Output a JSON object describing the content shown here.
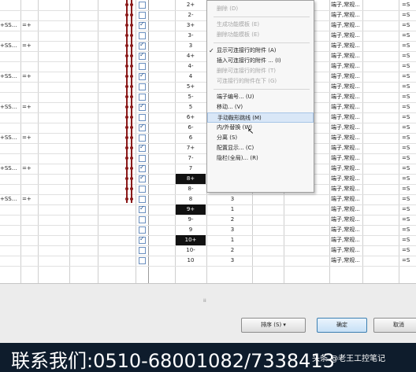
{
  "rows": [
    {
      "pin": "2+",
      "hl": false,
      "idx": "",
      "type": "端子,常规...",
      "eq": "=S",
      "checked": false,
      "left": "",
      "left2": ""
    },
    {
      "pin": "2-",
      "hl": false,
      "idx": "",
      "type": "端子,常规...",
      "eq": "=S",
      "checked": false,
      "left": "",
      "left2": ""
    },
    {
      "pin": "3+",
      "hl": false,
      "idx": "",
      "type": "端子,常规...",
      "eq": "=S",
      "checked": true,
      "left": "+SS...",
      "left2": "=+"
    },
    {
      "pin": "3-",
      "hl": false,
      "idx": "",
      "type": "端子,常规...",
      "eq": "=S",
      "checked": false,
      "left": "",
      "left2": ""
    },
    {
      "pin": "3",
      "hl": false,
      "idx": "",
      "type": "端子,常规...",
      "eq": "=S",
      "checked": true,
      "left": "+SS...",
      "left2": "=+"
    },
    {
      "pin": "4+",
      "hl": false,
      "idx": "",
      "type": "端子,常规...",
      "eq": "=S",
      "checked": true,
      "left": "",
      "left2": ""
    },
    {
      "pin": "4-",
      "hl": false,
      "idx": "",
      "type": "端子,常规...",
      "eq": "=S",
      "checked": false,
      "left": "",
      "left2": ""
    },
    {
      "pin": "4",
      "hl": false,
      "idx": "",
      "type": "端子,常规...",
      "eq": "=S",
      "checked": true,
      "left": "+SS...",
      "left2": "=+"
    },
    {
      "pin": "5+",
      "hl": false,
      "idx": "",
      "type": "端子,常规...",
      "eq": "=S",
      "checked": false,
      "left": "",
      "left2": ""
    },
    {
      "pin": "5-",
      "hl": false,
      "idx": "",
      "type": "端子,常规...",
      "eq": "=S",
      "checked": false,
      "left": "",
      "left2": ""
    },
    {
      "pin": "5",
      "hl": false,
      "idx": "",
      "type": "端子,常规...",
      "eq": "=S",
      "checked": true,
      "left": "+SS...",
      "left2": "=+"
    },
    {
      "pin": "6+",
      "hl": false,
      "idx": "",
      "type": "端子,常规...",
      "eq": "=S",
      "checked": false,
      "left": "",
      "left2": ""
    },
    {
      "pin": "6-",
      "hl": false,
      "idx": "",
      "type": "端子,常规...",
      "eq": "=S",
      "checked": true,
      "left": "",
      "left2": ""
    },
    {
      "pin": "6",
      "hl": false,
      "idx": "",
      "type": "端子,常规...",
      "eq": "=S",
      "checked": false,
      "left": "+SS...",
      "left2": "=+"
    },
    {
      "pin": "7+",
      "hl": false,
      "idx": "",
      "type": "端子,常规...",
      "eq": "=S",
      "checked": true,
      "left": "",
      "left2": ""
    },
    {
      "pin": "7-",
      "hl": false,
      "idx": "",
      "type": "端子,常规...",
      "eq": "=S",
      "checked": false,
      "left": "",
      "left2": ""
    },
    {
      "pin": "7",
      "hl": false,
      "idx": "",
      "type": "端子,常规...",
      "eq": "=S",
      "checked": true,
      "left": "+SS...",
      "left2": "=+"
    },
    {
      "pin": "8+",
      "hl": true,
      "idx": "",
      "type": "端子,常规...",
      "eq": "=S",
      "checked": true,
      "left": "",
      "left2": ""
    },
    {
      "pin": "8-",
      "hl": false,
      "idx": "2",
      "type": "端子,常规...",
      "eq": "=S",
      "checked": false,
      "left": "",
      "left2": ""
    },
    {
      "pin": "8",
      "hl": false,
      "idx": "3",
      "type": "端子,常规...",
      "eq": "=S",
      "checked": false,
      "left": "+SS...",
      "left2": "=+"
    },
    {
      "pin": "9+",
      "hl": true,
      "idx": "1",
      "type": "端子,常规...",
      "eq": "=S",
      "checked": true,
      "left": "",
      "left2": ""
    },
    {
      "pin": "9-",
      "hl": false,
      "idx": "2",
      "type": "端子,常规...",
      "eq": "=S",
      "checked": false,
      "left": "",
      "left2": ""
    },
    {
      "pin": "9",
      "hl": false,
      "idx": "3",
      "type": "端子,常规...",
      "eq": "=S",
      "checked": false,
      "left": "",
      "left2": ""
    },
    {
      "pin": "10+",
      "hl": true,
      "idx": "1",
      "type": "端子,常规...",
      "eq": "=S",
      "checked": true,
      "left": "",
      "left2": ""
    },
    {
      "pin": "10-",
      "hl": false,
      "idx": "2",
      "type": "端子,常规...",
      "eq": "=S",
      "checked": false,
      "left": "",
      "left2": ""
    },
    {
      "pin": "10",
      "hl": false,
      "idx": "3",
      "type": "端子,常规...",
      "eq": "=S",
      "checked": false,
      "left": "",
      "left2": ""
    }
  ],
  "menu": [
    {
      "label": "删除 (D)",
      "disabled": true,
      "checked": false,
      "hover": false
    },
    {
      "sep": true
    },
    {
      "label": "生成功能模板 (E)",
      "disabled": true,
      "checked": false,
      "hover": false
    },
    {
      "label": "删除功能模板 (E)",
      "disabled": true,
      "checked": false,
      "hover": false
    },
    {
      "sep": true
    },
    {
      "label": "显示可连接行的附件 (A)",
      "disabled": false,
      "checked": true,
      "hover": false
    },
    {
      "label": "插入可连接行的附件 ... (I)",
      "disabled": false,
      "checked": false,
      "hover": false
    },
    {
      "label": "删除可连接行的附件 (T)",
      "disabled": true,
      "checked": false,
      "hover": false
    },
    {
      "label": "可连接行的附件在下 (G)",
      "disabled": true,
      "checked": false,
      "hover": false
    },
    {
      "sep": true
    },
    {
      "label": "端子编号... (U)",
      "disabled": false,
      "checked": false,
      "hover": false
    },
    {
      "label": "移动... (V)",
      "disabled": false,
      "checked": false,
      "hover": false
    },
    {
      "label": "手动鞍形跳线 (M)",
      "disabled": false,
      "checked": false,
      "hover": true
    },
    {
      "label": "内/外替换 (W)",
      "disabled": false,
      "checked": false,
      "hover": false
    },
    {
      "label": "分离 (S)",
      "disabled": false,
      "checked": false,
      "hover": false
    },
    {
      "label": "配置显示... (C)",
      "disabled": false,
      "checked": false,
      "hover": false
    },
    {
      "label": "隐栏(全局)... (R)",
      "disabled": false,
      "checked": false,
      "hover": false
    }
  ],
  "buttons": {
    "sort": "排序 (S)",
    "sort_arrow": "▾",
    "ok": "确定",
    "cancel": "取消"
  },
  "banner": {
    "text": "联系我们:0510-68001082/7338413",
    "watermark": "头条 @老王工控笔记"
  },
  "grip": "⁞⁞"
}
